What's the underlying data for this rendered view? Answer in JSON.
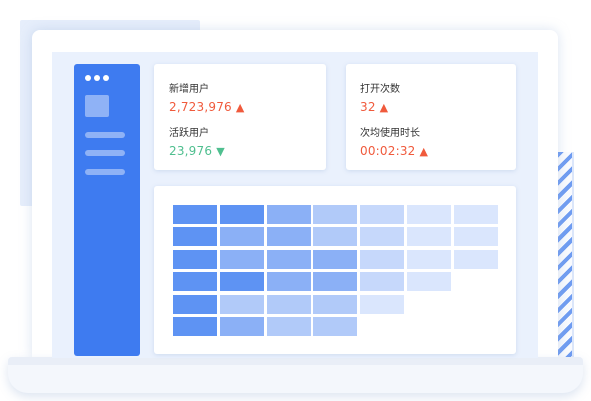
{
  "stats": {
    "card1": {
      "new_users_label": "新增用户",
      "new_users_value": "2,723,976",
      "new_users_trend": "up",
      "active_users_label": "活跃用户",
      "active_users_value": "23,976",
      "active_users_trend": "down"
    },
    "card2": {
      "opens_label": "打开次数",
      "opens_value": "32",
      "opens_trend": "up",
      "avg_time_label": "次均使用时长",
      "avg_time_value": "00:02:32",
      "avg_time_trend": "up"
    }
  },
  "icons": {
    "up": "▲",
    "down": "▼"
  },
  "colors": {
    "accent": "#3e7bf0",
    "up": "#f05a3c",
    "down": "#4fbf8f"
  },
  "retention_grid": {
    "rows": [
      [
        5,
        5,
        4,
        3,
        2,
        1,
        1
      ],
      [
        5,
        4,
        4,
        3,
        2,
        1,
        1
      ],
      [
        5,
        4,
        4,
        4,
        2,
        1,
        1
      ],
      [
        5,
        5,
        4,
        4,
        2,
        1
      ],
      [
        5,
        3,
        3,
        3,
        1
      ],
      [
        5,
        4,
        3,
        3
      ]
    ],
    "shade_colors": {
      "5": "#5e93f3",
      "4": "#8bb0f6",
      "3": "#b1caf9",
      "2": "#c6d8fb",
      "1": "#dae6fd"
    }
  }
}
